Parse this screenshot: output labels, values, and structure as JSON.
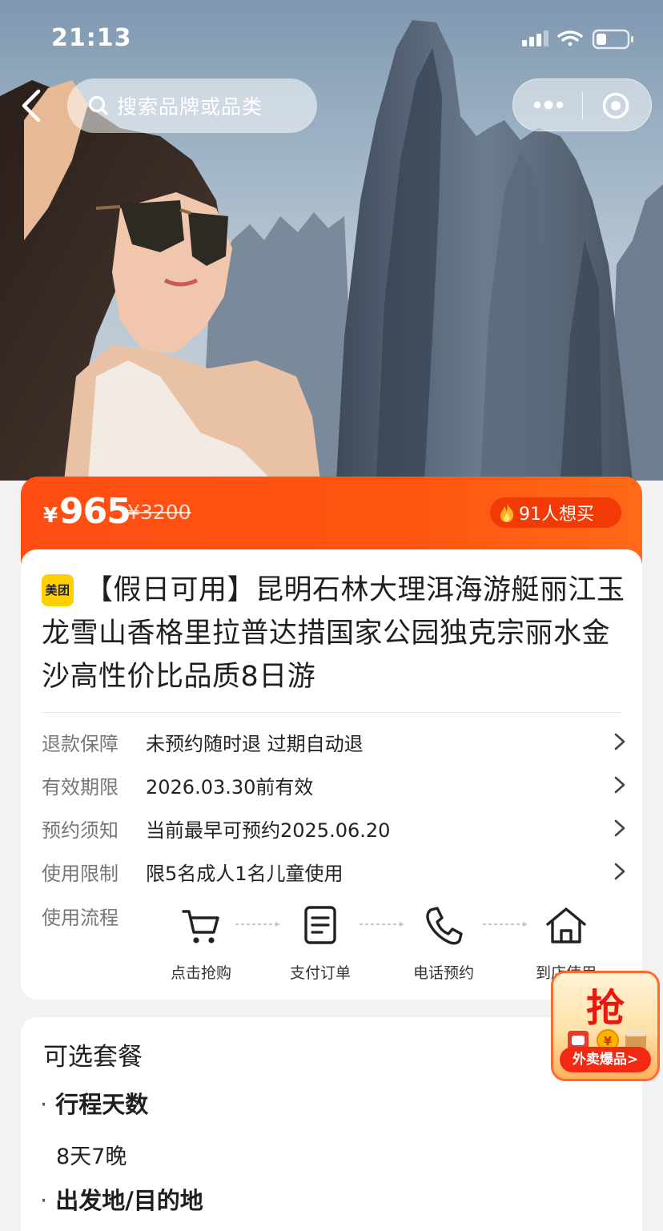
{
  "status_bar": {
    "time": "21:13"
  },
  "nav": {
    "search_placeholder": "搜索品牌或品类"
  },
  "price": {
    "currency": "¥",
    "current": "965",
    "original": "¥3200",
    "want_count_text": "91人想买"
  },
  "product": {
    "brand_logo_text": "美团",
    "title": "【假日可用】昆明石林大理洱海游艇丽江玉龙雪山香格里拉普达措国家公园独克宗丽水金沙高性价比品质8日游"
  },
  "info_rows": [
    {
      "label": "退款保障",
      "value": "未预约随时退 过期自动退"
    },
    {
      "label": "有效期限",
      "value": "2026.03.30前有效"
    },
    {
      "label": "预约须知",
      "value": "当前最早可预约2025.06.20"
    },
    {
      "label": "使用限制",
      "value": "限5名成人1名儿童使用"
    }
  ],
  "flow": {
    "label": "使用流程",
    "steps": [
      "点击抢购",
      "支付订单",
      "电话预约",
      "到店使用"
    ]
  },
  "options": {
    "title": "可选套餐",
    "groups": [
      {
        "name": "行程天数",
        "value": "8天7晚"
      },
      {
        "name": "出发地/目的地",
        "value": ""
      }
    ]
  },
  "promo": {
    "big_text": "抢",
    "label": "外卖爆品>"
  },
  "colors": {
    "accent": "#ff5010",
    "accent_dark": "#f23a07",
    "brand_yellow": "#ffd000"
  }
}
